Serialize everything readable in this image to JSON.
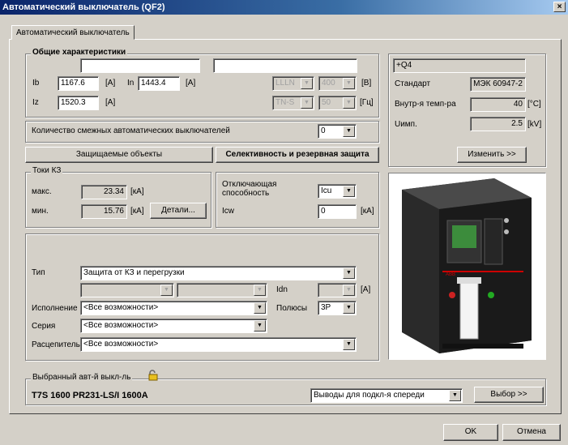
{
  "window": {
    "title": "Автоматический выключатель (QF2)",
    "close": "×"
  },
  "tab": {
    "label": "Автоматический выключатель"
  },
  "general": {
    "legend": "Общие характеристики",
    "name1": "",
    "name2": "",
    "ib_label": "Ib",
    "ib_value": "1167.6",
    "ib_unit": "[A]",
    "in_label": "In",
    "in_value": "1443.4",
    "in_unit": "[A]",
    "iz_label": "Iz",
    "iz_value": "1520.3",
    "iz_unit": "[A]",
    "system": "LLLN",
    "voltage": "400",
    "voltage_unit": "[В]",
    "earthing": "TN-S",
    "freq": "50",
    "freq_unit": "[Гц]"
  },
  "adjacent": {
    "label": "Количество смежных автоматических выключателей",
    "value": "0"
  },
  "buttons": {
    "protected": "Защищаемые объекты",
    "selectivity": "Селективность и резервная защита",
    "details": "Детали...",
    "change": "Изменить >>",
    "choose": "Выбор >>",
    "ok": "OK",
    "cancel": "Отмена"
  },
  "sc": {
    "legend": "Токи КЗ",
    "max_label": "макс.",
    "max_value": "23.34",
    "max_unit": "[кА]",
    "min_label": "мин.",
    "min_value": "15.76",
    "min_unit": "[кА]"
  },
  "breaking": {
    "label": "Отключающая способность",
    "value": "Icu",
    "icw_label": "Icw",
    "icw_value": "0",
    "icw_unit": "[кА]"
  },
  "info": {
    "code": "+Q4",
    "standard_label": "Стандарт",
    "standard_value": "МЭК 60947-2",
    "temp_label": "Внутр-я темп-ра",
    "temp_value": "40",
    "temp_unit": "[°C]",
    "uimp_label": "Uимп.",
    "uimp_value": "2.5",
    "uimp_unit": "[kV]"
  },
  "type": {
    "type_label": "Тип",
    "type_value": "Защита от КЗ и перегрузки",
    "sub1": "",
    "sub2": "",
    "idn_label": "Idn",
    "idn_value": "",
    "idn_unit": "[A]",
    "exec_label": "Исполнение",
    "exec_value": "<Все возможности>",
    "poles_label": "Полюсы",
    "poles_value": "3P",
    "series_label": "Серия",
    "series_value": "<Все возможности>",
    "release_label": "Расцепитель",
    "release_value": "<Все возможности>"
  },
  "selected": {
    "legend": "Выбранный авт-й выкл-ль",
    "model": "T7S 1600 PR231-LS/I 1600A",
    "terminals": "Выводы для подкл-я спереди"
  },
  "icons": {
    "lock": "lock-icon",
    "dropdown": "▼"
  },
  "colors": {
    "title_start": "#0a246a",
    "title_end": "#a6caf0",
    "face": "#d4d0c8"
  }
}
